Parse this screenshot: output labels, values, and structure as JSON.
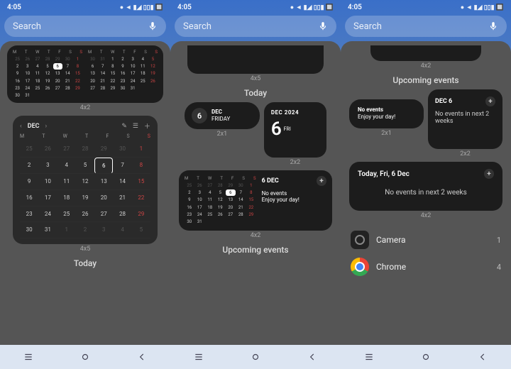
{
  "status": {
    "time": "4:05",
    "icons": "● ◄ ▮◢ ▯▯▮ 🔲"
  },
  "search": {
    "placeholder": "Search"
  },
  "labels": {
    "s4x2": "4x2",
    "s4x5": "4x5",
    "s2x1": "2x1",
    "s2x2": "2x2"
  },
  "sections": {
    "today": "Today",
    "upcoming": "Upcoming events"
  },
  "dow_short": [
    "M",
    "T",
    "W",
    "T",
    "F",
    "S",
    "S"
  ],
  "month_name": "DEC",
  "big_title_date": "6 DEC",
  "dec_year": "DEC 2024",
  "cal_prev": {
    "pre": [
      "25",
      "26",
      "27",
      "28",
      "29",
      "30"
    ],
    "days": 31,
    "today": 6,
    "post": [
      "1",
      "2",
      "3",
      "4",
      "5"
    ]
  },
  "cal_next": {
    "pre": [
      "30",
      "31"
    ],
    "days": 31,
    "today": null,
    "post": [
      "1",
      "2"
    ]
  },
  "events": {
    "no_events": "No events",
    "enjoy": "Enjoy your day!",
    "no2w": "No events in next 2 weeks",
    "fri": "FRIDAY",
    "fri_short": "FRI",
    "num": "6",
    "today_full": "Today, Fri, 6 Dec",
    "dec6": "DEC 6"
  },
  "apps": {
    "camera": {
      "name": "Camera",
      "count": "1"
    },
    "chrome": {
      "name": "Chrome",
      "count": "4"
    }
  }
}
